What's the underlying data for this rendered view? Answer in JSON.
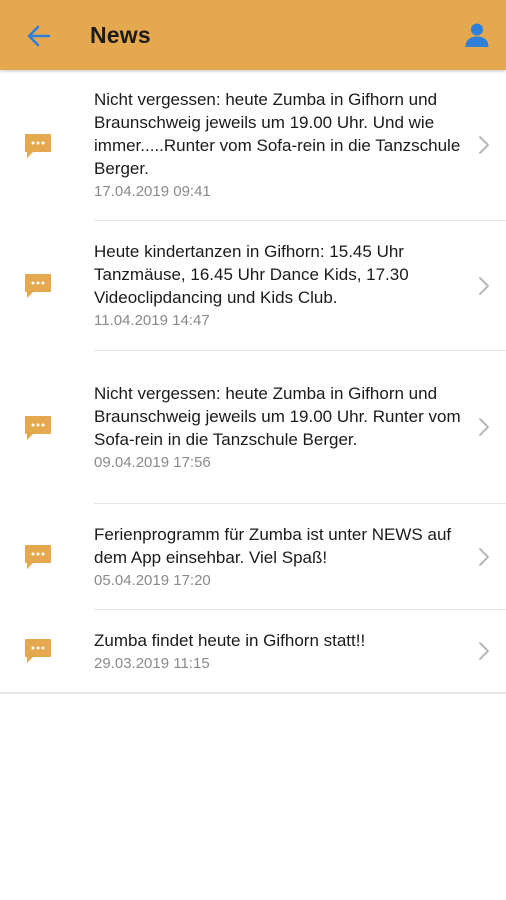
{
  "header": {
    "title": "News",
    "back_icon": "arrow-left-icon",
    "profile_icon": "user-icon",
    "background_color": "#E5A84E",
    "icon_color": "#2F80D8"
  },
  "news": [
    {
      "text": "Nicht vergessen: heute Zumba in Gifhorn und Braunschweig jeweils um 19.00 Uhr. Und wie immer.....Runter vom Sofa-rein in die Tanzschule Berger.",
      "date": "17.04.2019 09:41"
    },
    {
      "text": "Heute kindertanzen in Gifhorn: 15.45 Uhr Tanzmäuse, 16.45 Uhr Dance Kids, 17.30 Videoclipdancing und Kids Club.",
      "date": "11.04.2019 14:47"
    },
    {
      "text": "Nicht vergessen: heute Zumba in Gifhorn und Braunschweig jeweils um 19.00 Uhr. Runter vom Sofa-rein in die Tanzschule Berger.",
      "date": "09.04.2019 17:56"
    },
    {
      "text": "Ferienprogramm für Zumba ist unter NEWS auf dem App einsehbar. Viel Spaß!",
      "date": "05.04.2019 17:20"
    },
    {
      "text": "Zumba findet heute in Gifhorn statt!!",
      "date": "29.03.2019 11:15"
    }
  ],
  "item_icon": "message-bubble-icon",
  "item_icon_color": "#E5A84E",
  "chevron_icon": "chevron-right-icon"
}
